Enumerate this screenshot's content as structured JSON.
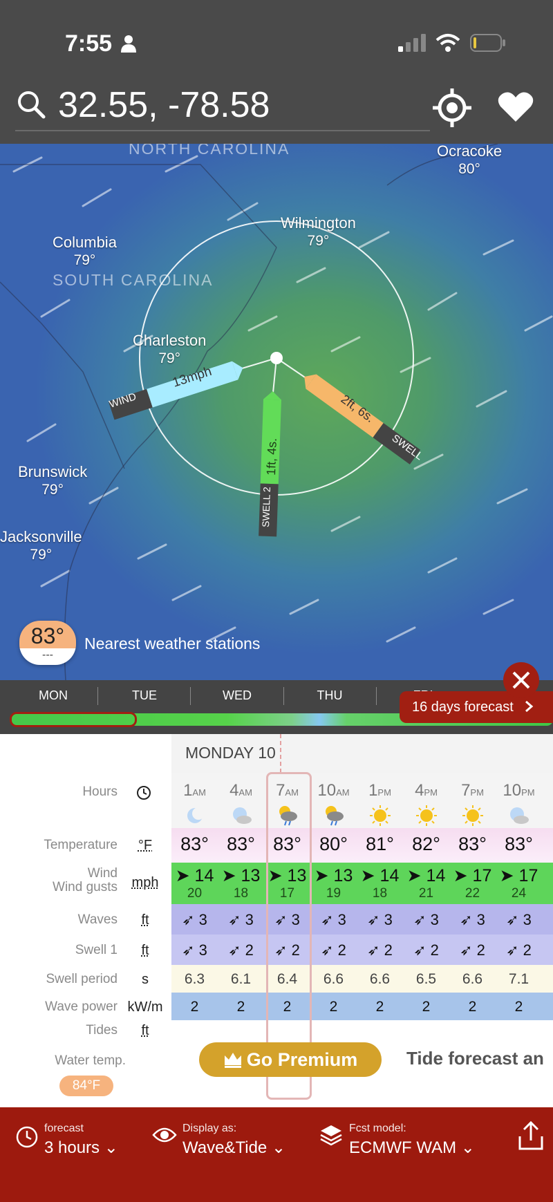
{
  "status_bar": {
    "time": "7:55"
  },
  "search": {
    "value": "32.55, -78.58"
  },
  "map": {
    "states": [
      "NORTH CAROLINA",
      "SOUTH CAROLINA"
    ],
    "cities": [
      {
        "name": "Ocracoke",
        "temp": "80°"
      },
      {
        "name": "Wilmington",
        "temp": "79°"
      },
      {
        "name": "Columbia",
        "temp": "79°"
      },
      {
        "name": "Charleston",
        "temp": "79°"
      },
      {
        "name": "Brunswick",
        "temp": "79°"
      },
      {
        "name": "Jacksonville",
        "temp": "79°"
      }
    ],
    "wind_label": "WIND",
    "wind_value": "13mph",
    "swell_label": "SWELL",
    "swell_value": "2ft, 6s.",
    "swell2_label": "SWELL 2",
    "swell2_value": "1ft, 4s.",
    "station_temp": "83°",
    "station_sub": "---",
    "station_label": "Nearest weather stations"
  },
  "days": [
    "MON",
    "TUE",
    "WED",
    "THU",
    "FRI"
  ],
  "forecast16_label": "16 days forecast",
  "table": {
    "day_title": "MONDAY 10",
    "labels": {
      "hours": "Hours",
      "temperature": "Temperature",
      "wind": "Wind",
      "wind_gusts": "Wind gusts",
      "waves": "Waves",
      "swell1": "Swell 1",
      "swell_period": "Swell period",
      "wave_power": "Wave power",
      "tides": "Tides",
      "water_temp": "Water temp."
    },
    "units": {
      "temperature": "°F",
      "wind": "mph",
      "waves": "ft",
      "swell1": "ft",
      "swell_period": "s",
      "wave_power": "kW/m",
      "tides": "ft"
    },
    "hours": [
      {
        "h": "1",
        "ap": "AM"
      },
      {
        "h": "4",
        "ap": "AM"
      },
      {
        "h": "7",
        "ap": "AM"
      },
      {
        "h": "10",
        "ap": "AM"
      },
      {
        "h": "1",
        "ap": "PM"
      },
      {
        "h": "4",
        "ap": "PM"
      },
      {
        "h": "7",
        "ap": "PM"
      },
      {
        "h": "10",
        "ap": "PM"
      }
    ],
    "weather_icons": [
      "moon-icon",
      "moon-cloud-icon",
      "sun-rain-icon",
      "sun-rain-icon",
      "sun-icon",
      "sun-icon",
      "sun-icon",
      "moon-cloud-icon"
    ],
    "temperature": [
      "83°",
      "83°",
      "83°",
      "80°",
      "81°",
      "82°",
      "83°",
      "83°"
    ],
    "wind": [
      "14",
      "13",
      "13",
      "13",
      "14",
      "14",
      "17",
      "17"
    ],
    "gusts": [
      "20",
      "18",
      "17",
      "19",
      "18",
      "21",
      "22",
      "24"
    ],
    "waves": [
      "3",
      "3",
      "3",
      "3",
      "3",
      "3",
      "3",
      "3"
    ],
    "swell1": [
      "3",
      "2",
      "2",
      "2",
      "2",
      "2",
      "2",
      "2"
    ],
    "swell_period": [
      "6.3",
      "6.1",
      "6.4",
      "6.6",
      "6.6",
      "6.5",
      "6.6",
      "7.1"
    ],
    "wave_power": [
      "2",
      "2",
      "2",
      "2",
      "2",
      "2",
      "2",
      "2"
    ],
    "water_temp": "84°F"
  },
  "premium_label": "Go Premium",
  "tide_forecast_text": "Tide forecast an",
  "bottom": {
    "forecast_small": "forecast",
    "forecast_big": "3 hours",
    "display_small": "Display as:",
    "display_big": "Wave&Tide",
    "model_small": "Fcst model:",
    "model_big": "ECMWF WAM"
  },
  "colors": {
    "accent": "#9d1a0e",
    "wind_green": "#5ed55a",
    "premium": "#d4a22b"
  }
}
